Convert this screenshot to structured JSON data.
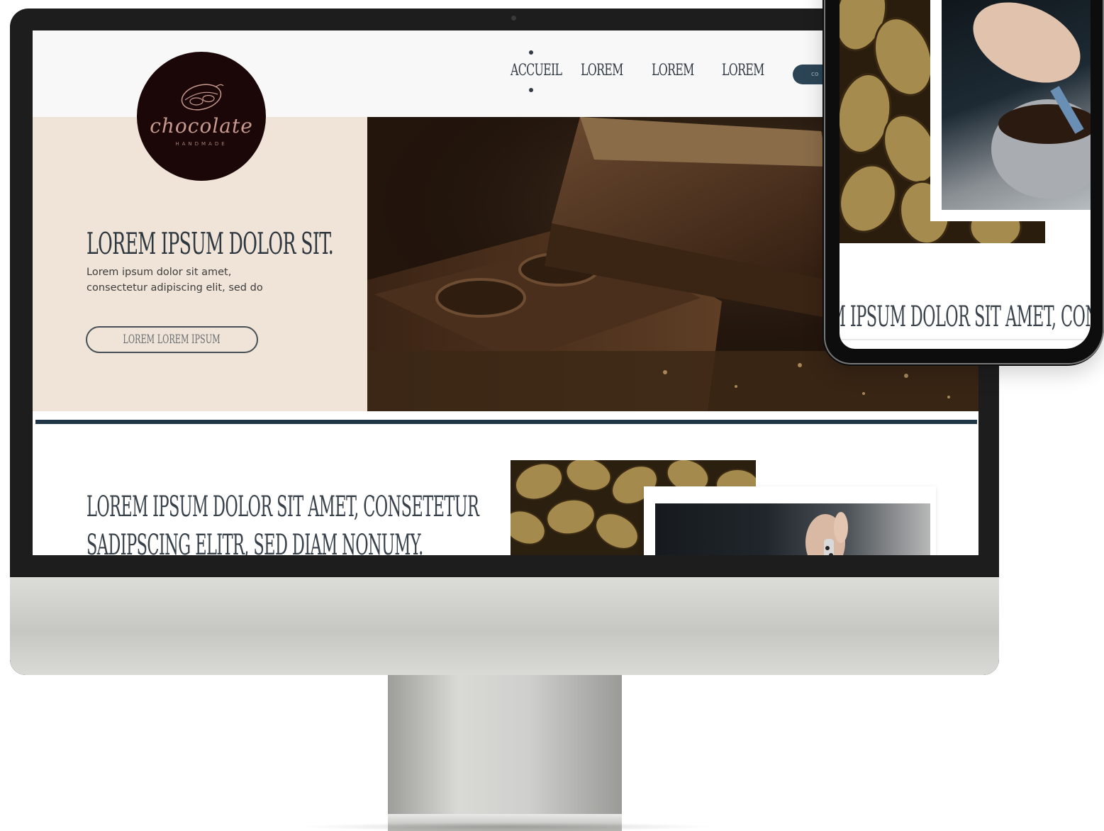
{
  "logo": {
    "wordmark": "chocolate",
    "tagline": "HANDMADE"
  },
  "nav": {
    "items": [
      "Accueil",
      "Lorem",
      "Lorem",
      "Lorem"
    ],
    "active_index": 0,
    "cta_label": "co"
  },
  "hero": {
    "title": "Lorem ipsum dolor sit.",
    "text_line1": "Lorem ipsum dolor sit amet,",
    "text_line2": "consectetur adipiscing elit, sed do",
    "button_label": "Lorem lorem ipsum",
    "image": "chocolate-bars-photo"
  },
  "section2": {
    "title_line1": "Lorem ipsum dolor sit amet, consetetur",
    "title_line2": "sadipscing elitr, sed diam nonumy.",
    "image1": "gold-cocoa-beans-photo",
    "image2": "hands-mixing-chocolate-photo"
  },
  "phone": {
    "image1": "gold-cocoa-beans-photo",
    "image2": "hands-mixing-chocolate-photo",
    "title": "m ipsum dolor sit amet, conset"
  },
  "colors": {
    "accent_dark": "#1f3746",
    "hero_bg": "#efe4d7",
    "logo_bg": "#1c0708",
    "text_dark": "#2e3740"
  }
}
